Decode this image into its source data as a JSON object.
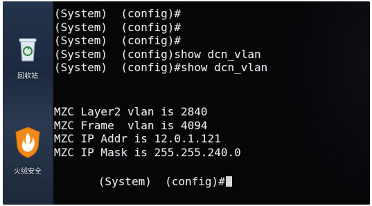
{
  "desktop": {
    "recycle_bin_label": "回收站",
    "security_app_label": "火绒安全",
    "recycle_icon": "recycle-bin-icon",
    "security_icon": "huorong-shield-icon"
  },
  "terminal": {
    "history": [
      "(System)  (config)#",
      "(System)  (config)#",
      "(System)  (config)#",
      "(System)  (config)show dcn_vlan",
      "(System)  (config)#show dcn_vlan"
    ],
    "output": [
      "MZC Layer2 vlan is 2840",
      "MZC Frame  vlan is 4094",
      "MZC IP Addr is 12.0.1.121",
      "MZC IP Mask is 255.255.240.0"
    ],
    "prompt": "(System)  (config)#",
    "colors": {
      "background": "#050608",
      "text": "#e7e7ea"
    }
  }
}
